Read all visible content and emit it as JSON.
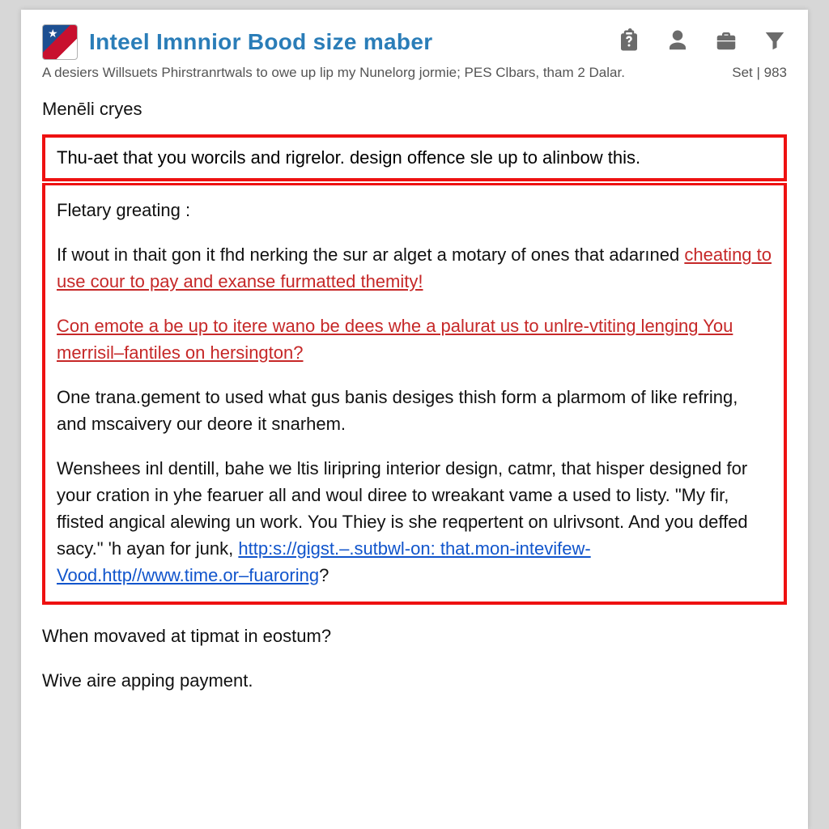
{
  "header": {
    "title": "Inteel Imnnior Bood size maber",
    "meta_left": "A desiers Willsuets Phirstranrtwals to owe up lip my Nunelorg jormie; PES Clbars, tham 2 Dalar.",
    "meta_right": "Set | 983"
  },
  "subject": "Menēli cryes",
  "box1_text": "Thu-aet that you worcils and rigrelor. design offence sle up to alinbow this.",
  "body": {
    "greeting": "Fletary greating :",
    "p1_plain": "If wout in thait gon it fhd nerking the sur ar alget a motary of ones that adarıned ",
    "p1_red": "cheating to use cour to pay and exanse furmatted themity!",
    "p2_red": "Con emote a be up to itere wano be dees whe a palurat us to unlre-vtiting lenging You merrisil–fantiles on hersington?",
    "p3": "One trana.gement to used what gus banis desiges thish form a plarmom of like refring, and mscaivery our deore it snarhem.",
    "p4_a": "Wenshees inl dentill, bahe we ltis liripring interior design, catmr, that hisper designed for your cration in yhe fearuer all and woul diree to wreakant vame a used to listy. \"My fir, ffisted angical alewing un work. You Thiey is she reqpertent on ulrivsont. And you deffed sacy.\" 'h ayan for junk, ",
    "p4_link": "http:s://gigst.–.sutbwl-on: that.mon-intevifew-Vood.http//www.time.or–fuaroring",
    "p4_b": "?"
  },
  "after": {
    "q": "When movaved at tipmat in eostum?",
    "line": "Wive aire apping payment."
  },
  "icons": {
    "clipboard": "clipboard-question-icon",
    "person": "person-icon",
    "briefcase": "briefcase-icon",
    "funnel": "funnel-icon"
  }
}
